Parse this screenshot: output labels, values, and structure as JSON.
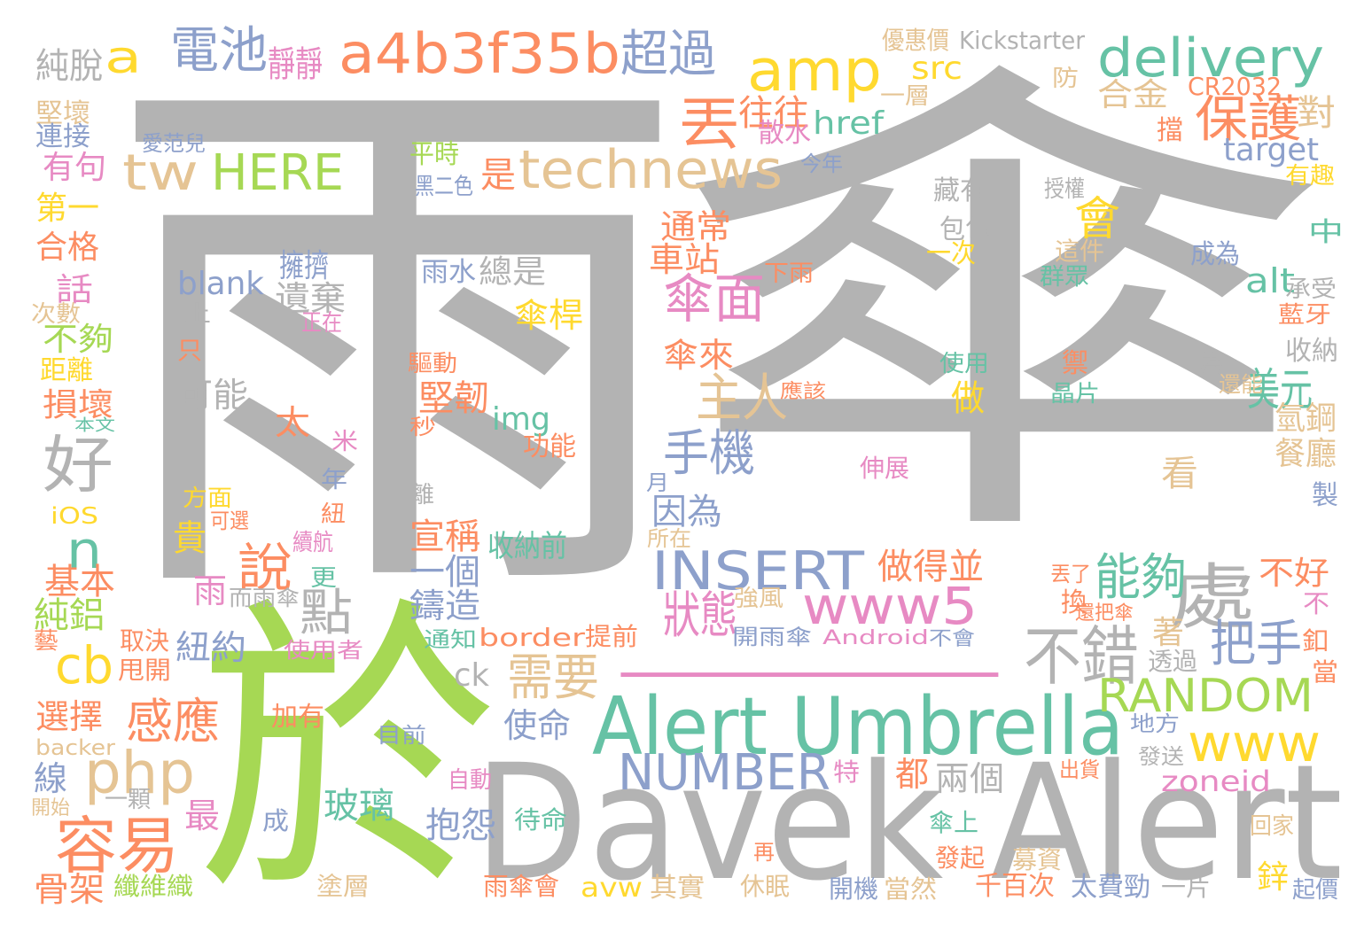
{
  "words": [
    {
      "text": "雨",
      "color": "#b3b3b3"
    },
    {
      "text": "傘",
      "color": "#b3b3b3"
    },
    {
      "text": "於",
      "color": "#a6d854"
    },
    {
      "text": "Davek Alert",
      "color": "#b3b3b3"
    },
    {
      "text": "一",
      "color": "#e78ac3"
    },
    {
      "text": "Alert Umbrella",
      "color": "#66c2a5"
    },
    {
      "text": "a4b3f35b",
      "color": "#fc8d62"
    },
    {
      "text": "technews",
      "color": "#e5c494"
    },
    {
      "text": "delivery",
      "color": "#66c2a5"
    },
    {
      "text": "INSERT",
      "color": "#8da0cb"
    },
    {
      "text": "amp",
      "color": "#ffd92f"
    },
    {
      "text": "www5",
      "color": "#e78ac3"
    },
    {
      "text": "電池",
      "color": "#8da0cb"
    },
    {
      "text": "超過",
      "color": "#8da0cb"
    },
    {
      "text": "好",
      "color": "#b3b3b3"
    },
    {
      "text": "處",
      "color": "#b3b3b3"
    },
    {
      "text": "不錯",
      "color": "#b3b3b3"
    },
    {
      "text": "php",
      "color": "#e5c494"
    },
    {
      "text": "容易",
      "color": "#fc8d62"
    },
    {
      "text": "RANDOM",
      "color": "#a6d854"
    },
    {
      "text": "www",
      "color": "#ffd92f"
    },
    {
      "text": "NUMBER",
      "color": "#8da0cb"
    },
    {
      "text": "tw",
      "color": "#e5c494"
    },
    {
      "text": "HERE",
      "color": "#a6d854"
    },
    {
      "text": "丟",
      "color": "#fc8d62"
    },
    {
      "text": "保護",
      "color": "#fc8d62"
    },
    {
      "text": "傘面",
      "color": "#e78ac3"
    },
    {
      "text": "主人",
      "color": "#e5c494"
    },
    {
      "text": "手機",
      "color": "#8da0cb"
    },
    {
      "text": "狀態",
      "color": "#e78ac3"
    },
    {
      "text": "能夠",
      "color": "#66c2a5"
    },
    {
      "text": "把手",
      "color": "#8da0cb"
    },
    {
      "text": "需要",
      "color": "#e5c494"
    },
    {
      "text": "感應",
      "color": "#fc8d62"
    },
    {
      "text": "說",
      "color": "#fc8d62"
    },
    {
      "text": "點",
      "color": "#b3b3b3"
    },
    {
      "text": "cb",
      "color": "#ffd92f"
    },
    {
      "text": "n",
      "color": "#66c2a5"
    },
    {
      "text": "a",
      "color": "#ffd92f"
    },
    {
      "text": "美元",
      "color": "#66c2a5"
    },
    {
      "text": "會",
      "color": "#ffd92f"
    },
    {
      "text": "純脫",
      "color": "#b3b3b3"
    },
    {
      "text": "靜靜",
      "color": "#e78ac3"
    },
    {
      "text": "往往",
      "color": "#fc8d62"
    },
    {
      "text": "是",
      "color": "#fc8d62"
    },
    {
      "text": "src",
      "color": "#ffd92f"
    },
    {
      "text": "href",
      "color": "#66c2a5"
    },
    {
      "text": "合金",
      "color": "#e5c494"
    },
    {
      "text": "target",
      "color": "#8da0cb"
    },
    {
      "text": "對",
      "color": "#e5c494"
    },
    {
      "text": "CR2032",
      "color": "#fc8d62"
    },
    {
      "text": "Kickstarter",
      "color": "#b3b3b3"
    },
    {
      "text": "優惠價",
      "color": "#e5c494"
    },
    {
      "text": "防",
      "color": "#e5c494"
    },
    {
      "text": "一層",
      "color": "#e5c494"
    },
    {
      "text": "擋",
      "color": "#fc8d62"
    },
    {
      "text": "有趣",
      "color": "#ffd92f"
    },
    {
      "text": "今年",
      "color": "#8da0cb"
    },
    {
      "text": "散水",
      "color": "#e78ac3"
    },
    {
      "text": "堅壞",
      "color": "#e5c494"
    },
    {
      "text": "連接",
      "color": "#8da0cb"
    },
    {
      "text": "愛范兒",
      "color": "#8da0cb"
    },
    {
      "text": "有句",
      "color": "#e78ac3"
    },
    {
      "text": "第一",
      "color": "#ffd92f"
    },
    {
      "text": "合格",
      "color": "#fc8d62"
    },
    {
      "text": "話",
      "color": "#e78ac3"
    },
    {
      "text": "次數",
      "color": "#e5c494"
    },
    {
      "text": "不夠",
      "color": "#a6d854"
    },
    {
      "text": "距離",
      "color": "#ffd92f"
    },
    {
      "text": "損壞",
      "color": "#fc8d62"
    },
    {
      "text": "本文",
      "color": "#66c2a5"
    },
    {
      "text": "平時",
      "color": "#a6d854"
    },
    {
      "text": "黑二色",
      "color": "#8da0cb"
    },
    {
      "text": "藏有",
      "color": "#b3b3b3"
    },
    {
      "text": "授權",
      "color": "#b3b3b3"
    },
    {
      "text": "包包",
      "color": "#b3b3b3"
    },
    {
      "text": "通常",
      "color": "#fc8d62"
    },
    {
      "text": "車站",
      "color": "#fc8d62"
    },
    {
      "text": "這件",
      "color": "#e5c494"
    },
    {
      "text": "一次",
      "color": "#ffd92f"
    },
    {
      "text": "成為",
      "color": "#8da0cb"
    },
    {
      "text": "群眾",
      "color": "#66c2a5"
    },
    {
      "text": "下雨",
      "color": "#fc8d62"
    },
    {
      "text": "alt",
      "color": "#66c2a5"
    },
    {
      "text": "承受",
      "color": "#b3b3b3"
    },
    {
      "text": "藍牙",
      "color": "#fc8d62"
    },
    {
      "text": "中",
      "color": "#66c2a5"
    },
    {
      "text": "收納",
      "color": "#b3b3b3"
    },
    {
      "text": "為",
      "color": "#b3b3b3"
    },
    {
      "text": "還能",
      "color": "#e5c494"
    },
    {
      "text": "晶片",
      "color": "#66c2a5"
    },
    {
      "text": "使用",
      "color": "#66c2a5"
    },
    {
      "text": "應該",
      "color": "#fc8d62"
    },
    {
      "text": "blank",
      "color": "#8da0cb"
    },
    {
      "text": "擁擠",
      "color": "#8da0cb"
    },
    {
      "text": "遺棄",
      "color": "#b3b3b3"
    },
    {
      "text": "雨水",
      "color": "#8da0cb"
    },
    {
      "text": "總是",
      "color": "#b3b3b3"
    },
    {
      "text": "傘桿",
      "color": "#ffd92f"
    },
    {
      "text": "傘來",
      "color": "#fc8d62"
    },
    {
      "text": "上",
      "color": "#b3b3b3"
    },
    {
      "text": "正在",
      "color": "#e78ac3"
    },
    {
      "text": "只",
      "color": "#fc8d62"
    },
    {
      "text": "驅動",
      "color": "#fc8d62"
    },
    {
      "text": "禦",
      "color": "#fc8d62"
    },
    {
      "text": "可能",
      "color": "#b3b3b3"
    },
    {
      "text": "堅韌",
      "color": "#fc8d62"
    },
    {
      "text": "img",
      "color": "#66c2a5"
    },
    {
      "text": "太",
      "color": "#fc8d62"
    },
    {
      "text": "秒",
      "color": "#fc8d62"
    },
    {
      "text": "米",
      "color": "#e78ac3"
    },
    {
      "text": "功能",
      "color": "#fc8d62"
    },
    {
      "text": "做",
      "color": "#ffd92f"
    },
    {
      "text": "氫鋼",
      "color": "#e5c494"
    },
    {
      "text": "餐廳",
      "color": "#e5c494"
    },
    {
      "text": "看",
      "color": "#e5c494"
    },
    {
      "text": "伸展",
      "color": "#e78ac3"
    },
    {
      "text": "製",
      "color": "#8da0cb"
    },
    {
      "text": "方面",
      "color": "#ffd92f"
    },
    {
      "text": "年",
      "color": "#8da0cb"
    },
    {
      "text": "離",
      "color": "#b3b3b3"
    },
    {
      "text": "月",
      "color": "#8da0cb"
    },
    {
      "text": "iOS",
      "color": "#ffd92f"
    },
    {
      "text": "可選",
      "color": "#fc8d62"
    },
    {
      "text": "紐",
      "color": "#fc8d62"
    },
    {
      "text": "所在",
      "color": "#e5c494"
    },
    {
      "text": "貴",
      "color": "#ffd92f"
    },
    {
      "text": "續航",
      "color": "#e78ac3"
    },
    {
      "text": "因為",
      "color": "#8da0cb"
    },
    {
      "text": "宣稱",
      "color": "#fc8d62"
    },
    {
      "text": "收納前",
      "color": "#66c2a5"
    },
    {
      "text": "做得並",
      "color": "#fc8d62"
    },
    {
      "text": "不好",
      "color": "#fc8d62"
    },
    {
      "text": "基本",
      "color": "#fc8d62"
    },
    {
      "text": "雨",
      "color": "#e78ac3"
    },
    {
      "text": "更",
      "color": "#66c2a5"
    },
    {
      "text": "而雨傘",
      "color": "#b3b3b3"
    },
    {
      "text": "一個",
      "color": "#8da0cb"
    },
    {
      "text": "丟了",
      "color": "#fc8d62"
    },
    {
      "text": "換",
      "color": "#fc8d62"
    },
    {
      "text": "還把傘",
      "color": "#fc8d62"
    },
    {
      "text": "不",
      "color": "#e78ac3"
    },
    {
      "text": "純鋁",
      "color": "#a6d854"
    },
    {
      "text": "鑄造",
      "color": "#8da0cb"
    },
    {
      "text": "強風",
      "color": "#e5c494"
    },
    {
      "text": "開雨傘",
      "color": "#8da0cb"
    },
    {
      "text": "釦",
      "color": "#fc8d62"
    },
    {
      "text": "藝",
      "color": "#fc8d62"
    },
    {
      "text": "取決",
      "color": "#fc8d62"
    },
    {
      "text": "紐約",
      "color": "#8da0cb"
    },
    {
      "text": "使用者",
      "color": "#e78ac3"
    },
    {
      "text": "通知",
      "color": "#66c2a5"
    },
    {
      "text": "border",
      "color": "#fc8d62"
    },
    {
      "text": "提前",
      "color": "#fc8d62"
    },
    {
      "text": "Android",
      "color": "#e78ac3"
    },
    {
      "text": "不會",
      "color": "#8da0cb"
    },
    {
      "text": "著",
      "color": "#e5c494"
    },
    {
      "text": "透過",
      "color": "#b3b3b3"
    },
    {
      "text": "當",
      "color": "#fc8d62"
    },
    {
      "text": "甩開",
      "color": "#fc8d62"
    },
    {
      "text": "ck",
      "color": "#b3b3b3"
    },
    {
      "text": "選擇",
      "color": "#fc8d62"
    },
    {
      "text": "加有",
      "color": "#fc8d62"
    },
    {
      "text": "使命",
      "color": "#8da0cb"
    },
    {
      "text": "地方",
      "color": "#8da0cb"
    },
    {
      "text": "backer",
      "color": "#e5c494"
    },
    {
      "text": "目前",
      "color": "#8da0cb"
    },
    {
      "text": "發送",
      "color": "#b3b3b3"
    },
    {
      "text": "線",
      "color": "#8da0cb"
    },
    {
      "text": "兩個",
      "color": "#b3b3b3"
    },
    {
      "text": "都",
      "color": "#fc8d62"
    },
    {
      "text": "特",
      "color": "#e78ac3"
    },
    {
      "text": "出貨",
      "color": "#fc8d62"
    },
    {
      "text": "zoneid",
      "color": "#e78ac3"
    },
    {
      "text": "自動",
      "color": "#e78ac3"
    },
    {
      "text": "一顆",
      "color": "#b3b3b3"
    },
    {
      "text": "開始",
      "color": "#e5c494"
    },
    {
      "text": "玻璃",
      "color": "#66c2a5"
    },
    {
      "text": "抱怨",
      "color": "#8da0cb"
    },
    {
      "text": "最",
      "color": "#e78ac3"
    },
    {
      "text": "成",
      "color": "#8da0cb"
    },
    {
      "text": "待命",
      "color": "#66c2a5"
    },
    {
      "text": "傘上",
      "color": "#66c2a5"
    },
    {
      "text": "回家",
      "color": "#e5c494"
    },
    {
      "text": "再",
      "color": "#fc8d62"
    },
    {
      "text": "發起",
      "color": "#fc8d62"
    },
    {
      "text": "募資",
      "color": "#e5c494"
    },
    {
      "text": "骨架",
      "color": "#fc8d62"
    },
    {
      "text": "纖維織",
      "color": "#a6d854"
    },
    {
      "text": "塗層",
      "color": "#e5c494"
    },
    {
      "text": "雨傘會",
      "color": "#fc8d62"
    },
    {
      "text": "avw",
      "color": "#ffd92f"
    },
    {
      "text": "其實",
      "color": "#e5c494"
    },
    {
      "text": "休眠",
      "color": "#e5c494"
    },
    {
      "text": "開機",
      "color": "#8da0cb"
    },
    {
      "text": "當然",
      "color": "#e5c494"
    },
    {
      "text": "千百次",
      "color": "#fc8d62"
    },
    {
      "text": "太費勁",
      "color": "#8da0cb"
    },
    {
      "text": "一片",
      "color": "#b3b3b3"
    },
    {
      "text": "鋅",
      "color": "#ffd92f"
    },
    {
      "text": "起價",
      "color": "#8da0cb"
    }
  ]
}
